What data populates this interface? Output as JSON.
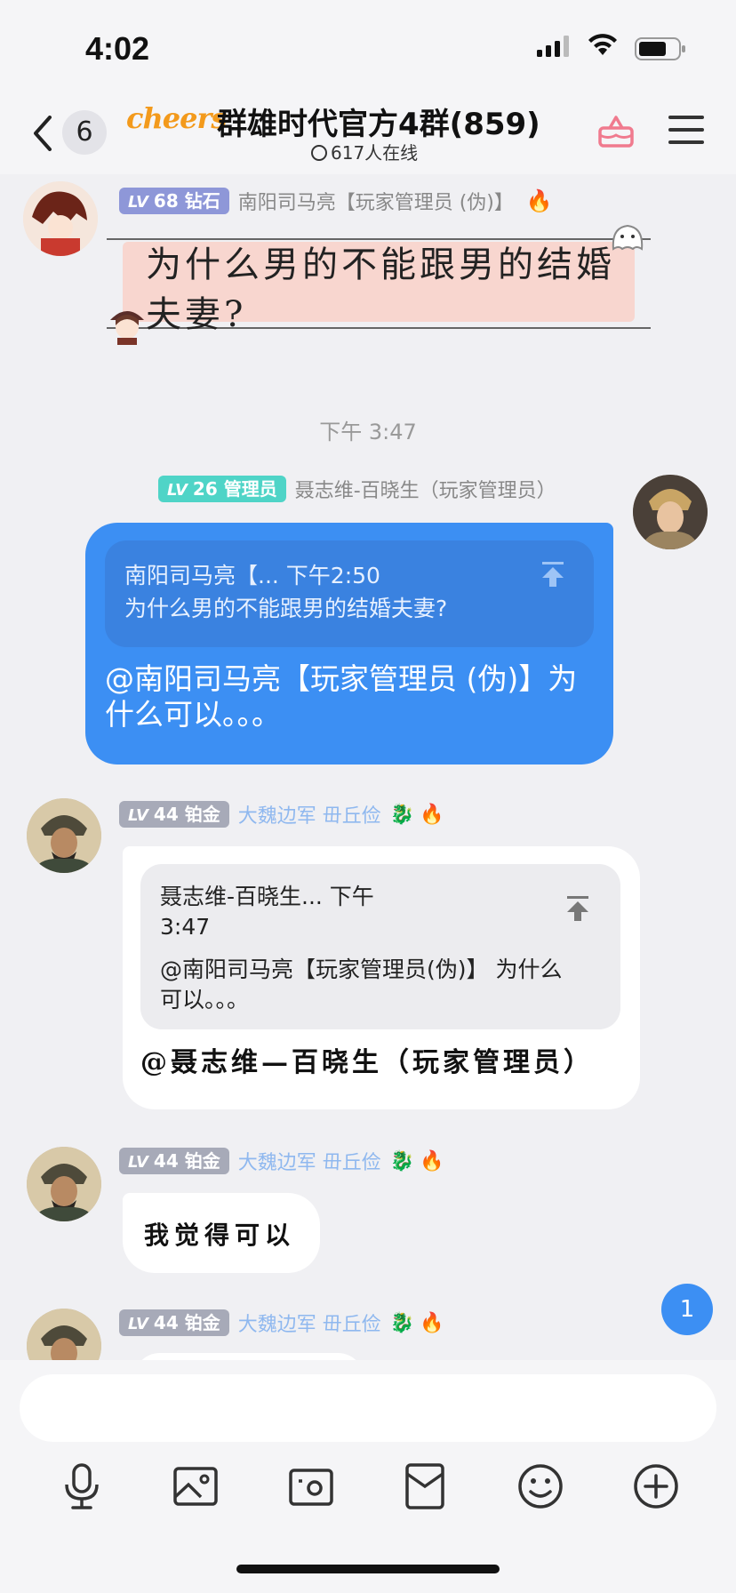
{
  "status": {
    "time": "4:02"
  },
  "header": {
    "back_count": "6",
    "badge_text": "cheers",
    "title": "群雄时代官方4群(859)",
    "online": "617人在线"
  },
  "messages": [
    {
      "level_prefix": "LV",
      "level": "68",
      "rank": "钻石",
      "nickname": "南阳司马亮【玩家管理员 (伪)】",
      "sticker_text": "为什么男的不能跟男的结婚夫妻?"
    },
    {
      "timestamp": "下午 3:47"
    },
    {
      "level_prefix": "LV",
      "level": "26",
      "rank": "管理员",
      "nickname": "聂志维-百晓生（玩家管理员）",
      "quote_meta": "南阳司马亮【... 下午2:50",
      "quote_text": "为什么男的不能跟男的结婚夫妻?",
      "text": "@南阳司马亮【玩家管理员 (伪)】为什么可以。。。"
    },
    {
      "level_prefix": "LV",
      "level": "44",
      "rank": "铂金",
      "nickname": "大魏边军 毌丘俭",
      "quote_meta": "聂志维-百晓生... 下午3:47",
      "quote_text": "@南阳司马亮【玩家管理员(伪)】 为什么可以。。。",
      "text": "@聂志维—百晓生（玩家管理员）"
    },
    {
      "level_prefix": "LV",
      "level": "44",
      "rank": "铂金",
      "nickname": "大魏边军 毌丘俭",
      "text": "我觉得可以"
    },
    {
      "level_prefix": "LV",
      "level": "44",
      "rank": "铂金",
      "nickname": "大魏边军 毌丘俭"
    }
  ],
  "unread_count": "1",
  "colors": {
    "accent": "#3c8ff3",
    "admin_badge": "#4fd4c7",
    "diamond_badge": "#8e97d8",
    "platinum_badge": "#a7aab8"
  },
  "toolbar": [
    "microphone-icon",
    "image-icon",
    "camera-icon",
    "red-packet-icon",
    "emoji-icon",
    "plus-icon"
  ]
}
